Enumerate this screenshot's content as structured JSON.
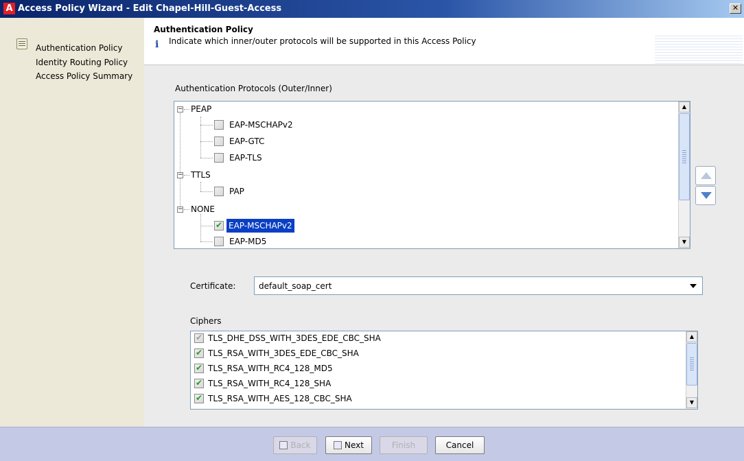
{
  "window": {
    "title": "Access Policy Wizard - Edit Chapel-Hill-Guest-Access",
    "logo_letter": "A",
    "close_label": "✕"
  },
  "sidebar": {
    "items": [
      {
        "label": "Authentication Policy"
      },
      {
        "label": "Identity Routing Policy"
      },
      {
        "label": "Access Policy Summary"
      }
    ]
  },
  "header": {
    "title": "Authentication Policy",
    "info_icon": "i",
    "description": "Indicate which inner/outer protocols will be supported in this Access Policy"
  },
  "protocols": {
    "label": "Authentication Protocols (Outer/Inner)",
    "groups": [
      {
        "name": "PEAP",
        "children": [
          {
            "label": "EAP-MSCHAPv2",
            "checked": false
          },
          {
            "label": "EAP-GTC",
            "checked": false
          },
          {
            "label": "EAP-TLS",
            "checked": false
          }
        ]
      },
      {
        "name": "TTLS",
        "children": [
          {
            "label": "PAP",
            "checked": false
          }
        ]
      },
      {
        "name": "NONE",
        "children": [
          {
            "label": "EAP-MSCHAPv2",
            "checked": true,
            "selected": true
          },
          {
            "label": "EAP-MD5",
            "checked": false
          }
        ]
      }
    ]
  },
  "certificate": {
    "label": "Certificate:",
    "value": "default_soap_cert"
  },
  "ciphers": {
    "label": "Ciphers",
    "items": [
      {
        "label": "TLS_DHE_DSS_WITH_3DES_EDE_CBC_SHA",
        "checked": true,
        "disabled": true
      },
      {
        "label": "TLS_RSA_WITH_3DES_EDE_CBC_SHA",
        "checked": true
      },
      {
        "label": "TLS_RSA_WITH_RC4_128_MD5",
        "checked": true
      },
      {
        "label": "TLS_RSA_WITH_RC4_128_SHA",
        "checked": true
      },
      {
        "label": "TLS_RSA_WITH_AES_128_CBC_SHA",
        "checked": true
      }
    ]
  },
  "footer": {
    "back_label": "Back",
    "next_label": "Next",
    "finish_label": "Finish",
    "cancel_label": "Cancel"
  },
  "colors": {
    "titlebar": "#0a246a",
    "selection": "#0a3fc4",
    "footer": "#c4c9e6",
    "check": "#2a9a2a"
  }
}
